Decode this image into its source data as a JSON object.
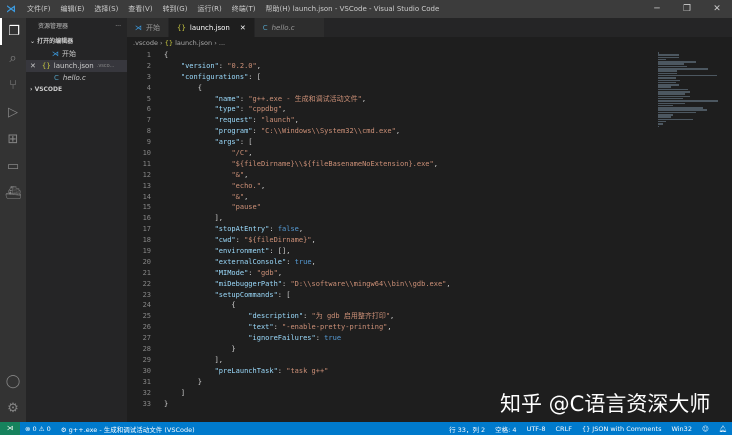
{
  "titlebar": {
    "title": "launch.json - VSCode - Visual Studio Code",
    "menus": [
      "文件(F)",
      "编辑(E)",
      "选择(S)",
      "查看(V)",
      "转到(G)",
      "运行(R)",
      "终端(T)",
      "帮助(H)"
    ]
  },
  "sidebar": {
    "header": "资源管理器",
    "more": "···",
    "open_editors": "打开的编辑器",
    "files": [
      {
        "name": "开始",
        "icon": "vscode-icon"
      },
      {
        "name": "launch.json",
        "hint": ".vsco...",
        "icon": "json-icon"
      },
      {
        "name": "hello.c",
        "icon": "c-icon"
      }
    ],
    "folder": "VSCODE"
  },
  "tabs": [
    {
      "label": "开始"
    },
    {
      "label": "launch.json"
    },
    {
      "label": "hello.c"
    }
  ],
  "breadcrumb": {
    "folder": ".vscode",
    "file": "launch.json",
    "rest": "..."
  },
  "code": [
    [
      [
        "p",
        "{"
      ]
    ],
    [
      [
        "p",
        "    "
      ],
      [
        "k",
        "\"version\""
      ],
      [
        "p",
        ": "
      ],
      [
        "s",
        "\"0.2.0\""
      ],
      [
        "p",
        ","
      ]
    ],
    [
      [
        "p",
        "    "
      ],
      [
        "k",
        "\"configurations\""
      ],
      [
        "p",
        ": ["
      ]
    ],
    [
      [
        "p",
        "        {"
      ]
    ],
    [
      [
        "p",
        "            "
      ],
      [
        "k",
        "\"name\""
      ],
      [
        "p",
        ": "
      ],
      [
        "s",
        "\"g++.exe - 生成和调试活动文件\""
      ],
      [
        "p",
        ","
      ]
    ],
    [
      [
        "p",
        "            "
      ],
      [
        "k",
        "\"type\""
      ],
      [
        "p",
        ": "
      ],
      [
        "s",
        "\"cppdbg\""
      ],
      [
        "p",
        ","
      ]
    ],
    [
      [
        "p",
        "            "
      ],
      [
        "k",
        "\"request\""
      ],
      [
        "p",
        ": "
      ],
      [
        "s",
        "\"launch\""
      ],
      [
        "p",
        ","
      ]
    ],
    [
      [
        "p",
        "            "
      ],
      [
        "k",
        "\"program\""
      ],
      [
        "p",
        ": "
      ],
      [
        "s",
        "\"C:\\\\Windows\\\\System32\\\\cmd.exe\""
      ],
      [
        "p",
        ","
      ]
    ],
    [
      [
        "p",
        "            "
      ],
      [
        "k",
        "\"args\""
      ],
      [
        "p",
        ": ["
      ]
    ],
    [
      [
        "p",
        "                "
      ],
      [
        "s",
        "\"/C\""
      ],
      [
        "p",
        ","
      ]
    ],
    [
      [
        "p",
        "                "
      ],
      [
        "s",
        "\"${fileDirname}\\\\${fileBasenameNoExtension}.exe\""
      ],
      [
        "p",
        ","
      ]
    ],
    [
      [
        "p",
        "                "
      ],
      [
        "s",
        "\"&\""
      ],
      [
        "p",
        ","
      ]
    ],
    [
      [
        "p",
        "                "
      ],
      [
        "s",
        "\"echo.\""
      ],
      [
        "p",
        ","
      ]
    ],
    [
      [
        "p",
        "                "
      ],
      [
        "s",
        "\"&\""
      ],
      [
        "p",
        ","
      ]
    ],
    [
      [
        "p",
        "                "
      ],
      [
        "s",
        "\"pause\""
      ]
    ],
    [
      [
        "p",
        "            ],"
      ]
    ],
    [
      [
        "p",
        "            "
      ],
      [
        "k",
        "\"stopAtEntry\""
      ],
      [
        "p",
        ": "
      ],
      [
        "b",
        "false"
      ],
      [
        "p",
        ","
      ]
    ],
    [
      [
        "p",
        "            "
      ],
      [
        "k",
        "\"cwd\""
      ],
      [
        "p",
        ": "
      ],
      [
        "s",
        "\"${fileDirname}\""
      ],
      [
        "p",
        ","
      ]
    ],
    [
      [
        "p",
        "            "
      ],
      [
        "k",
        "\"environment\""
      ],
      [
        "p",
        ": [],"
      ]
    ],
    [
      [
        "p",
        "            "
      ],
      [
        "k",
        "\"externalConsole\""
      ],
      [
        "p",
        ": "
      ],
      [
        "b",
        "true"
      ],
      [
        "p",
        ","
      ]
    ],
    [
      [
        "p",
        "            "
      ],
      [
        "k",
        "\"MIMode\""
      ],
      [
        "p",
        ": "
      ],
      [
        "s",
        "\"gdb\""
      ],
      [
        "p",
        ","
      ]
    ],
    [
      [
        "p",
        "            "
      ],
      [
        "k",
        "\"miDebuggerPath\""
      ],
      [
        "p",
        ": "
      ],
      [
        "s",
        "\"D:\\\\software\\\\mingw64\\\\bin\\\\gdb.exe\""
      ],
      [
        "p",
        ","
      ]
    ],
    [
      [
        "p",
        "            "
      ],
      [
        "k",
        "\"setupCommands\""
      ],
      [
        "p",
        ": ["
      ]
    ],
    [
      [
        "p",
        "                {"
      ]
    ],
    [
      [
        "p",
        "                    "
      ],
      [
        "k",
        "\"description\""
      ],
      [
        "p",
        ": "
      ],
      [
        "s",
        "\"为 gdb 启用整齐打印\""
      ],
      [
        "p",
        ","
      ]
    ],
    [
      [
        "p",
        "                    "
      ],
      [
        "k",
        "\"text\""
      ],
      [
        "p",
        ": "
      ],
      [
        "s",
        "\"-enable-pretty-printing\""
      ],
      [
        "p",
        ","
      ]
    ],
    [
      [
        "p",
        "                    "
      ],
      [
        "k",
        "\"ignoreFailures\""
      ],
      [
        "p",
        ": "
      ],
      [
        "b",
        "true"
      ]
    ],
    [
      [
        "p",
        "                }"
      ]
    ],
    [
      [
        "p",
        "            ],"
      ]
    ],
    [
      [
        "p",
        "            "
      ],
      [
        "k",
        "\"preLaunchTask\""
      ],
      [
        "p",
        ": "
      ],
      [
        "s",
        "\"task g++\""
      ]
    ],
    [
      [
        "p",
        "        }"
      ]
    ],
    [
      [
        "p",
        "    ]"
      ]
    ],
    [
      [
        "p",
        "}"
      ]
    ]
  ],
  "status": {
    "errors": "0",
    "warnings": "0",
    "launch": "g++.exe - 生成和调试活动文件 (VSCode)",
    "position": "行 33，列 2",
    "spaces": "空格: 4",
    "encoding": "UTF-8",
    "eol": "CRLF",
    "language": "JSON with Comments",
    "platform": "Win32"
  },
  "watermark": "知乎 @C语言资深大师"
}
